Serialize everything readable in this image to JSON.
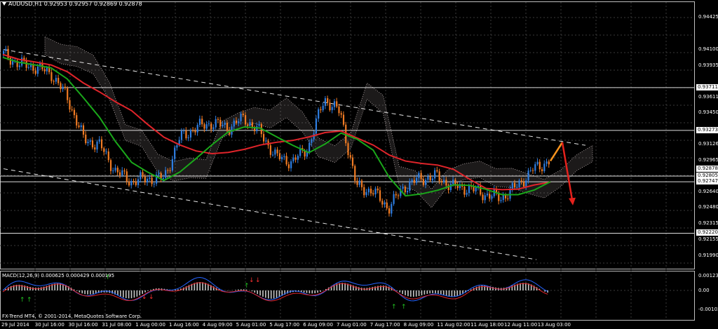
{
  "window": {
    "symbol_title": "AUDUSD,H1  0.92953 0.92957 0.92869 0.92878",
    "macd_title": "MACD(12,26,9) 0.000625 0.000429 0.000195",
    "copyright": "FX-Trend MT4, © 2001-2014, MetaQuotes Software Corp."
  },
  "colors": {
    "background": "#000000",
    "grid": "#3a3a3a",
    "bull_candle": "#2e7de0",
    "bear_candle": "#f07b24",
    "ma_red": "#e0242a",
    "ma_green": "#1aa81a",
    "cloud": "#e7d8d8",
    "channel": "#e6e6e6",
    "arrow_up": "#f7931e",
    "arrow_down": "#e5211c",
    "macd_hist": "#c8c8c8",
    "macd_line": "#2563ff",
    "macd_signal": "#e0242a"
  },
  "price_axis": {
    "labels": [
      "0.94425",
      "0.94100",
      "0.93935",
      "0.93611",
      "0.93450",
      "0.93126",
      "0.92965",
      "0.92640",
      "0.92480",
      "0.92315",
      "0.92155",
      "0.91990"
    ],
    "top_label": "0.94425",
    "boxed_levels": [
      "0.93711",
      "0.93273",
      "0.92878",
      "0.92805",
      "0.92747",
      "0.92220"
    ],
    "range": [
      0.9185,
      0.9455
    ]
  },
  "macd_axis": {
    "labels": [
      "0.001232",
      "0.00",
      "-0.001034"
    ]
  },
  "time_axis": {
    "labels": [
      "29 Jul 2014",
      "30 Jul 16:00",
      "30 Jul 16:00",
      "31 Jul 08:00",
      "1 Aug 00:00",
      "1 Aug 16:00",
      "4 Aug 09:00",
      "5 Aug 01:00",
      "5 Aug 17:00",
      "6 Aug 09:00",
      "7 Aug 01:00",
      "7 Aug 17:00",
      "8 Aug 09:00",
      "11 Aug 02:00",
      "11 Aug 18:00",
      "12 Aug 11:00",
      "13 Aug 03:00"
    ]
  },
  "chart_data": {
    "type": "candlestick",
    "symbol": "AUDUSD",
    "timeframe": "H1",
    "ohlc_current": {
      "open": 0.92953,
      "high": 0.92957,
      "low": 0.92869,
      "close": 0.92878
    },
    "approx_close_path": [
      0.9405,
      0.9395,
      0.9392,
      0.9385,
      0.936,
      0.9318,
      0.9312,
      0.9285,
      0.9275,
      0.9278,
      0.9278,
      0.932,
      0.933,
      0.9335,
      0.933,
      0.934,
      0.9325,
      0.93,
      0.9295,
      0.931,
      0.936,
      0.9345,
      0.927,
      0.9265,
      0.9248,
      0.927,
      0.9278,
      0.928,
      0.927,
      0.9268,
      0.9262,
      0.9258,
      0.927,
      0.9287,
      0.9296
    ],
    "horizontal_levels": [
      0.93711,
      0.93273,
      0.92805,
      0.92747,
      0.9222
    ],
    "projection": {
      "up_to": 0.9315,
      "down_to": 0.9252
    }
  }
}
